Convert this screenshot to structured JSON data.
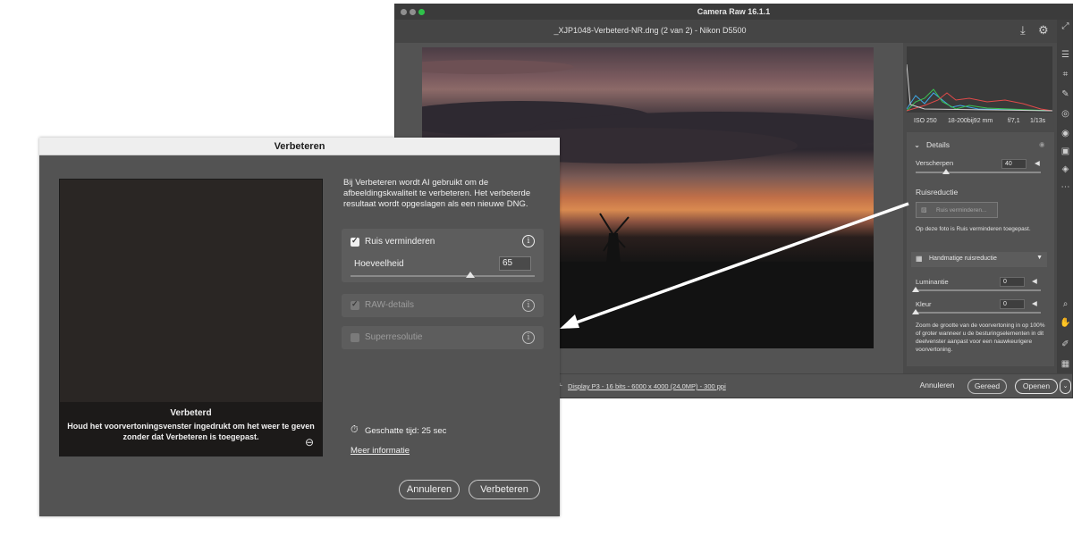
{
  "camera_raw": {
    "window_title": "Camera Raw 16.1.1",
    "file_title": "_XJP1048-Verbeterd-NR.dng (2 van 2)  -  Nikon D5500",
    "exif": {
      "iso": "ISO 250",
      "lens": "18-200bij92 mm",
      "aperture": "f/7,1",
      "shutter": "1/13s"
    },
    "details": {
      "header": "Details",
      "sharpen_label": "Verscherpen",
      "sharpen_value": "40",
      "noise_section": "Ruisreductie",
      "noise_button": "Ruis verminderen...",
      "noise_applied_note": "Op deze foto is Ruis verminderen toegepast.",
      "manual_header": "Handmatige ruisreductie",
      "luminance_label": "Luminantie",
      "luminance_value": "0",
      "color_label": "Kleur",
      "color_value": "0",
      "zoom_note": "Zoom de grootte van de voorvertoning in op 100% of groter wanneer u de besturingselementen in dit deelvenster aanpast voor een nauwkeurigere voorvertoning."
    },
    "rating_stars": "☆☆☆☆☆",
    "footer_link": "Display P3 - 16 bits - 6000 x 4000 (24,0MP) - 300 ppi",
    "buttons": {
      "cancel": "Annuleren",
      "done": "Gereed",
      "open": "Openen"
    },
    "colors": {
      "window_bg": "#535353",
      "panel_bg": "#4a4a4a",
      "toolstrip": "#3f3f3f"
    }
  },
  "dialog": {
    "title": "Verbeteren",
    "description": "Bij Verbeteren wordt AI gebruikt om de afbeeldingskwaliteit te verbeteren. Het verbeterde resultaat wordt opgeslagen als een nieuwe DNG.",
    "preview_overlay": {
      "title": "Verbeterd",
      "text": "Houd het voorvertoningsvenster ingedrukt om het weer te geven zonder dat Verbeteren is toegepast."
    },
    "options": {
      "noise": {
        "label": "Ruis verminderen",
        "checked": true,
        "amount_label": "Hoeveelheid",
        "amount_value": "65",
        "amount_level": 0.65
      },
      "raw_details": {
        "label": "RAW-details",
        "checked": true,
        "enabled": false
      },
      "super_resolution": {
        "label": "Superresolutie",
        "checked": false,
        "enabled": false
      }
    },
    "estimated_time": "Geschatte tijd: 25 sec",
    "more_info": "Meer informatie",
    "buttons": {
      "cancel": "Annuleren",
      "enhance": "Verbeteren"
    },
    "icons": [
      "info-icon",
      "timer-icon",
      "zoom-out-icon"
    ],
    "colors": {
      "dialog_bg": "#535353",
      "option_bg": "#5d5d5d",
      "titlebar_bg": "#eeeeee"
    }
  }
}
